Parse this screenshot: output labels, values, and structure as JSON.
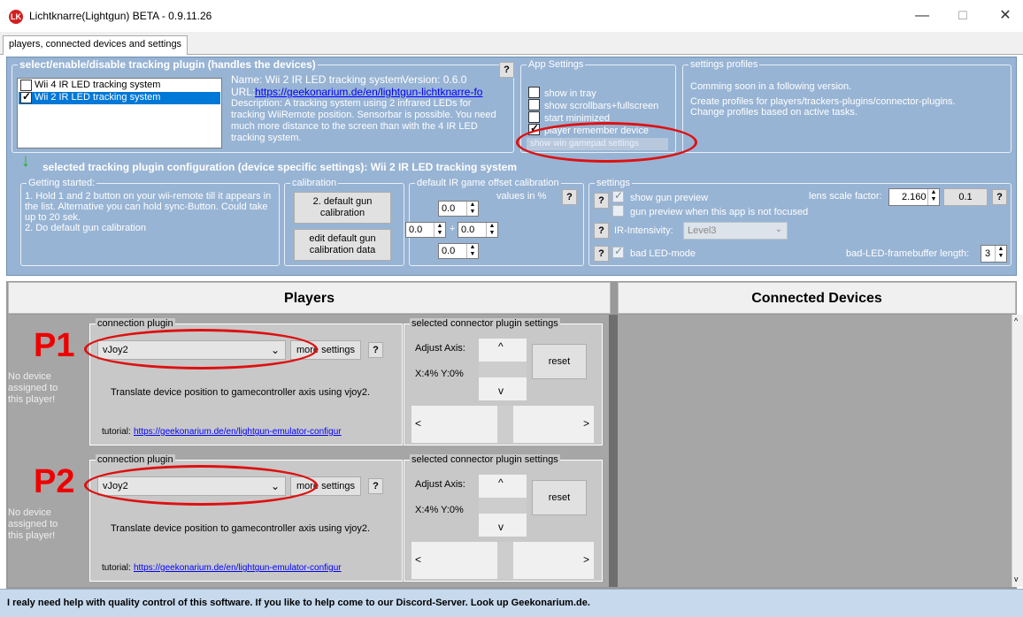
{
  "window": {
    "title": "Lichtknarre(Lightgun) BETA - 0.9.11.26",
    "minimize": "—",
    "maximize": "☐",
    "close": "✕",
    "icon_text": "LK"
  },
  "tabs": [
    "players, connected devices and settings"
  ],
  "plugin_select": {
    "heading": "select/enable/disable tracking plugin (handles the devices)",
    "items": [
      {
        "label": "Wii 4 IR LED tracking system",
        "checked": false,
        "selected": false
      },
      {
        "label": "Wii 2 IR LED tracking system",
        "checked": true,
        "selected": true
      }
    ],
    "name": "Name:  Wii 2 IR LED tracking system",
    "version": "Version:  0.6.0",
    "url_label": "URL:",
    "url": "https://geekonarium.de/en/lightgun-lichtknarre-fo",
    "description": "Description: A tracking system using 2 infrared LEDs for tracking WiiRemote position. Sensorbar is possible. You need much more distance to the screen than with the 4 IR LED tracking system.",
    "help": "?"
  },
  "app_settings": {
    "heading": "App Settings",
    "options": [
      {
        "label": "show in tray",
        "checked": false
      },
      {
        "label": "show scrollbars+fullscreen",
        "checked": false
      },
      {
        "label": "start minimized",
        "checked": false
      },
      {
        "label": "player remember device",
        "checked": true
      }
    ],
    "gamepad_button": "show win gamepad settings"
  },
  "settings_profiles": {
    "heading": "settings profiles",
    "line1": "Comming soon in a following version.",
    "line2": "Create profiles for players/trackers-plugins/connector-plugins.",
    "line3": "Change profiles based on active tasks."
  },
  "plugin_config": {
    "arrow": "↓",
    "heading": "selected tracking plugin configuration (device specific settings): Wii 2 IR LED tracking system",
    "getting_started": {
      "heading": "Getting started:",
      "text": "1. Hold 1 and 2 button on your wii-remote till it appears in the list. Alternative you can hold sync-Button. Could take up to 20 sek.\n2. Do default gun calibration"
    },
    "calibration": {
      "heading": "calibration",
      "button1": "2. default gun calibration",
      "button2": "edit default gun calibration data"
    },
    "ir_offset": {
      "heading": "default IR game offset calibration",
      "values_label": "values in %",
      "help": "?",
      "top": "0.0",
      "left": "0.0",
      "plus": "+",
      "right": "0.0",
      "bottom": "0.0"
    },
    "settings": {
      "heading": "settings",
      "show_gun_preview": "show gun preview",
      "gun_preview_unfocused": "gun preview when this app is not focused",
      "lens_label": "lens scale factor:",
      "lens_value": "2.160",
      "lens_step": "0.1",
      "ir_label": "IR-Intensivity:",
      "ir_value": "Level3",
      "bad_led": "bad LED-mode",
      "framebuffer_label": "bad-LED-framebuffer length:",
      "framebuffer_value": "3",
      "help": "?"
    }
  },
  "players_header": "Players",
  "devices_header": "Connected Devices",
  "players": [
    {
      "label": "P1",
      "no_device": "No device assigned to this player!",
      "plugin_heading": "connection plugin",
      "plugin_value": "vJoy2",
      "more_settings": "more settings",
      "help": "?",
      "description": "Translate device position to gamecontroller axis using vjoy2.",
      "tutorial_label": "tutorial:",
      "tutorial_url": "https://geekonarium.de/en/lightgun-emulator-configur",
      "connector_heading": "selected connector plugin settings",
      "adjust_label": "Adjust Axis:",
      "axis_values": "X:4% Y:0%",
      "reset": "reset"
    },
    {
      "label": "P2",
      "no_device": "No device assigned to this player!",
      "plugin_heading": "connection plugin",
      "plugin_value": "vJoy2",
      "more_settings": "more settings",
      "help": "?",
      "description": "Translate device position to gamecontroller axis using vjoy2.",
      "tutorial_label": "tutorial:",
      "tutorial_url": "https://geekonarium.de/en/lightgun-emulator-configur",
      "connector_heading": "selected connector plugin settings",
      "adjust_label": "Adjust Axis:",
      "axis_values": "X:4% Y:0%",
      "reset": "reset"
    }
  ],
  "status": "I realy need help with quality control of this software. If you like to help come to our Discord-Server. Look up Geekonarium.de.",
  "colors": {
    "panel": "#98b4d4",
    "annotation": "#dd1111",
    "player_label": "#ee0000",
    "status_bar": "#c7d9ed"
  }
}
